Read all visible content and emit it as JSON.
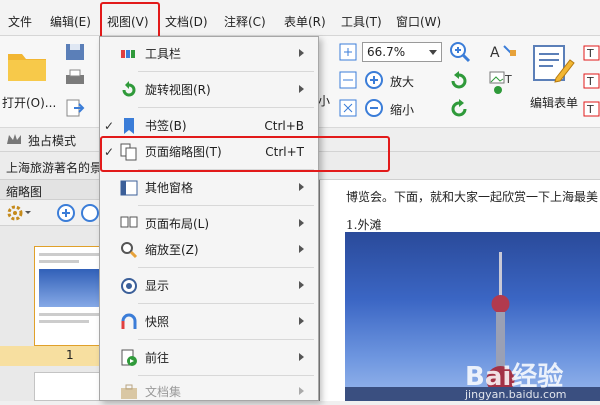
{
  "menubar": {
    "items": [
      {
        "label": "文件"
      },
      {
        "label": "编辑(E)"
      },
      {
        "label": "视图(V)"
      },
      {
        "label": "文档(D)"
      },
      {
        "label": "注释(C)"
      },
      {
        "label": "表单(R)"
      },
      {
        "label": "工具(T)"
      },
      {
        "label": "窗口(W)"
      }
    ]
  },
  "ribbon": {
    "open_label": "打开(O)...",
    "zoom_value": "66.7%",
    "zoom_in_label": "放大",
    "zoom_out_label": "缩小",
    "small_label": "小",
    "edit_form_label": "编辑表单"
  },
  "toolbar2": {
    "exclusive_mode": "独占模式"
  },
  "doc_tab": {
    "title": "上海旅游著名的景"
  },
  "thumb_pane": {
    "title": "缩略图",
    "page_number": "1"
  },
  "document": {
    "text_line1": "博览会。下面，就和大家一起欣赏一下上海最美",
    "text_line2": "1.外滩",
    "watermark_main": "Bai经验",
    "watermark_url": "jingyan.baidu.com"
  },
  "view_menu": {
    "items": [
      {
        "label": "工具栏",
        "shortcut": ""
      },
      {
        "label": "旋转视图(R)",
        "shortcut": ""
      },
      {
        "label": "书签(B)",
        "shortcut": "Ctrl+B"
      },
      {
        "label": "页面缩略图(T)",
        "shortcut": "Ctrl+T"
      },
      {
        "label": "其他窗格",
        "shortcut": ""
      },
      {
        "label": "页面布局(L)",
        "shortcut": ""
      },
      {
        "label": "缩放至(Z)",
        "shortcut": ""
      },
      {
        "label": "显示",
        "shortcut": ""
      },
      {
        "label": "快照",
        "shortcut": ""
      },
      {
        "label": "前往",
        "shortcut": ""
      },
      {
        "label": "文档集",
        "shortcut": ""
      }
    ]
  },
  "colors": {
    "highlight_red": "#e21a1a",
    "page_selected": "#f7dfa0"
  }
}
